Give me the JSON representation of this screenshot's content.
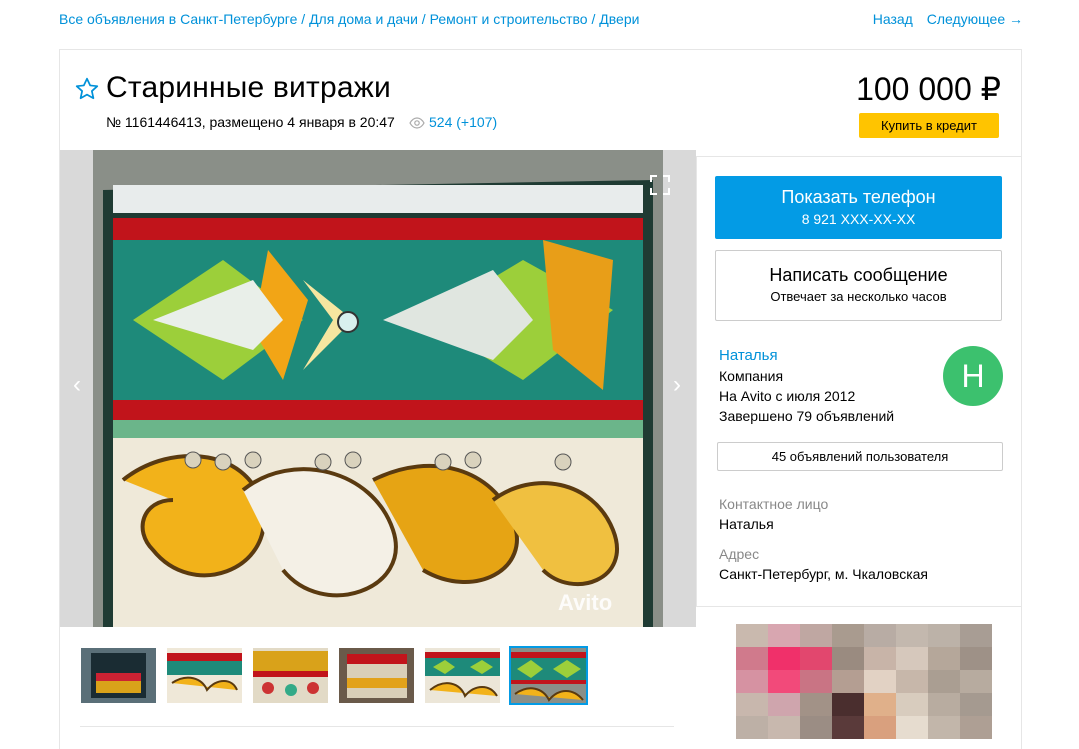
{
  "breadcrumbs": {
    "items": [
      "Все объявления в Санкт-Петербурге",
      "Для дома и дачи",
      "Ремонт и строительство",
      "Двери"
    ],
    "separator": " / "
  },
  "nav": {
    "back": "Назад",
    "next": "Следующее →"
  },
  "listing": {
    "title": "Старинные витражи",
    "meta": "№ 1161446413, размещено 4 января в 20:47",
    "views": "524 (+107)",
    "price": "100 000 ₽",
    "credit_button": "Купить в кредит"
  },
  "gallery": {
    "watermark": "Avito",
    "thumbnail_count": 6,
    "selected_thumbnail": 6
  },
  "contact": {
    "phone_button": "Показать телефон",
    "phone_masked": "8 921 XXX-XX-XX",
    "message_button": "Написать сообщение",
    "message_sub": "Отвечает за несколько часов"
  },
  "seller": {
    "name": "Наталья",
    "type": "Компания",
    "since": "На Avito с июля 2012",
    "completed": "Завершено 79 объявлений",
    "avatar_letter": "Н",
    "avatar_color": "#3cc16e",
    "ads_button": "45 объявлений пользователя"
  },
  "details": {
    "contact_label": "Контактное лицо",
    "contact_value": "Наталья",
    "address_label": "Адрес",
    "address_value": "Санкт-Петербург, м. Чкаловская"
  },
  "colors": {
    "accent": "#0091d9",
    "phone_button": "#039be5",
    "credit_button": "#ffc400"
  }
}
